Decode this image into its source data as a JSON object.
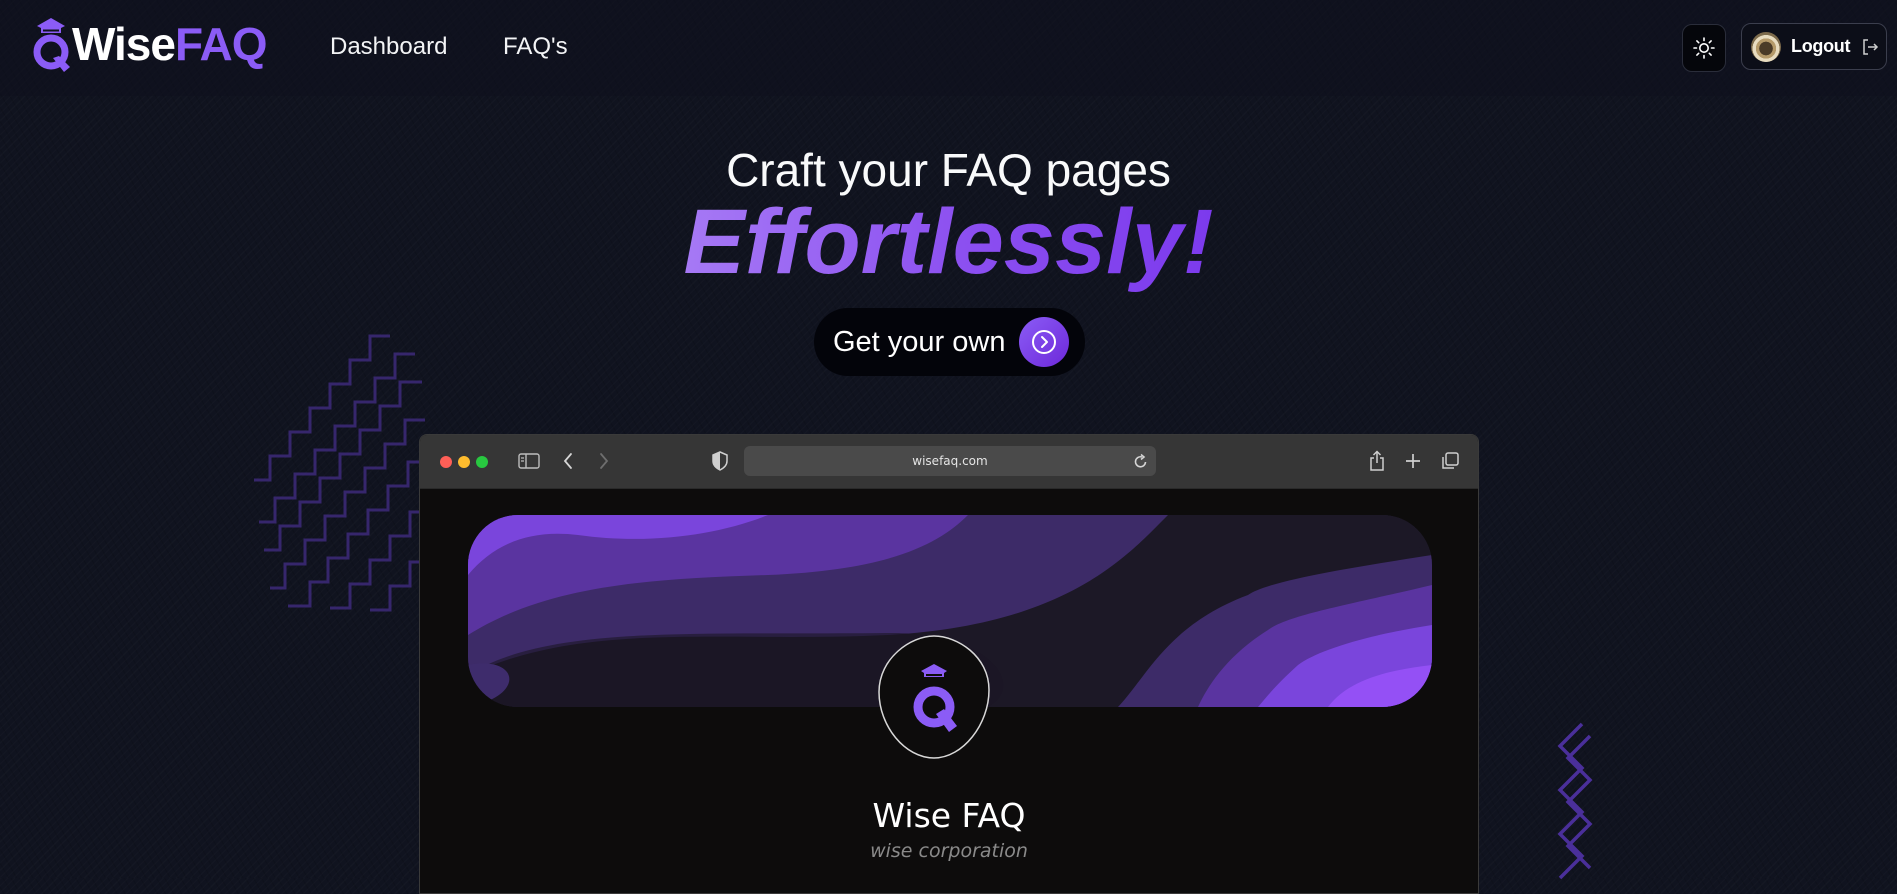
{
  "brand": {
    "wise": "Wise",
    "faq": "FAQ"
  },
  "nav": {
    "items": [
      {
        "label": "Dashboard"
      },
      {
        "label": "FAQ's"
      }
    ]
  },
  "header": {
    "theme_icon": "sun-icon",
    "logout_label": "Logout",
    "logout_icon": "logout-icon"
  },
  "hero": {
    "title": "Craft your FAQ pages",
    "emphasis": "Effortlessly!",
    "cta_label": "Get your own",
    "cta_icon": "chevron-right-circle-icon"
  },
  "preview": {
    "url": "wisefaq.com",
    "profile_name": "Wise FAQ",
    "profile_org": "wise corporation"
  },
  "colors": {
    "accent": "#8b5cf6",
    "accent_dark": "#6d28d9",
    "background": "#10131f"
  }
}
